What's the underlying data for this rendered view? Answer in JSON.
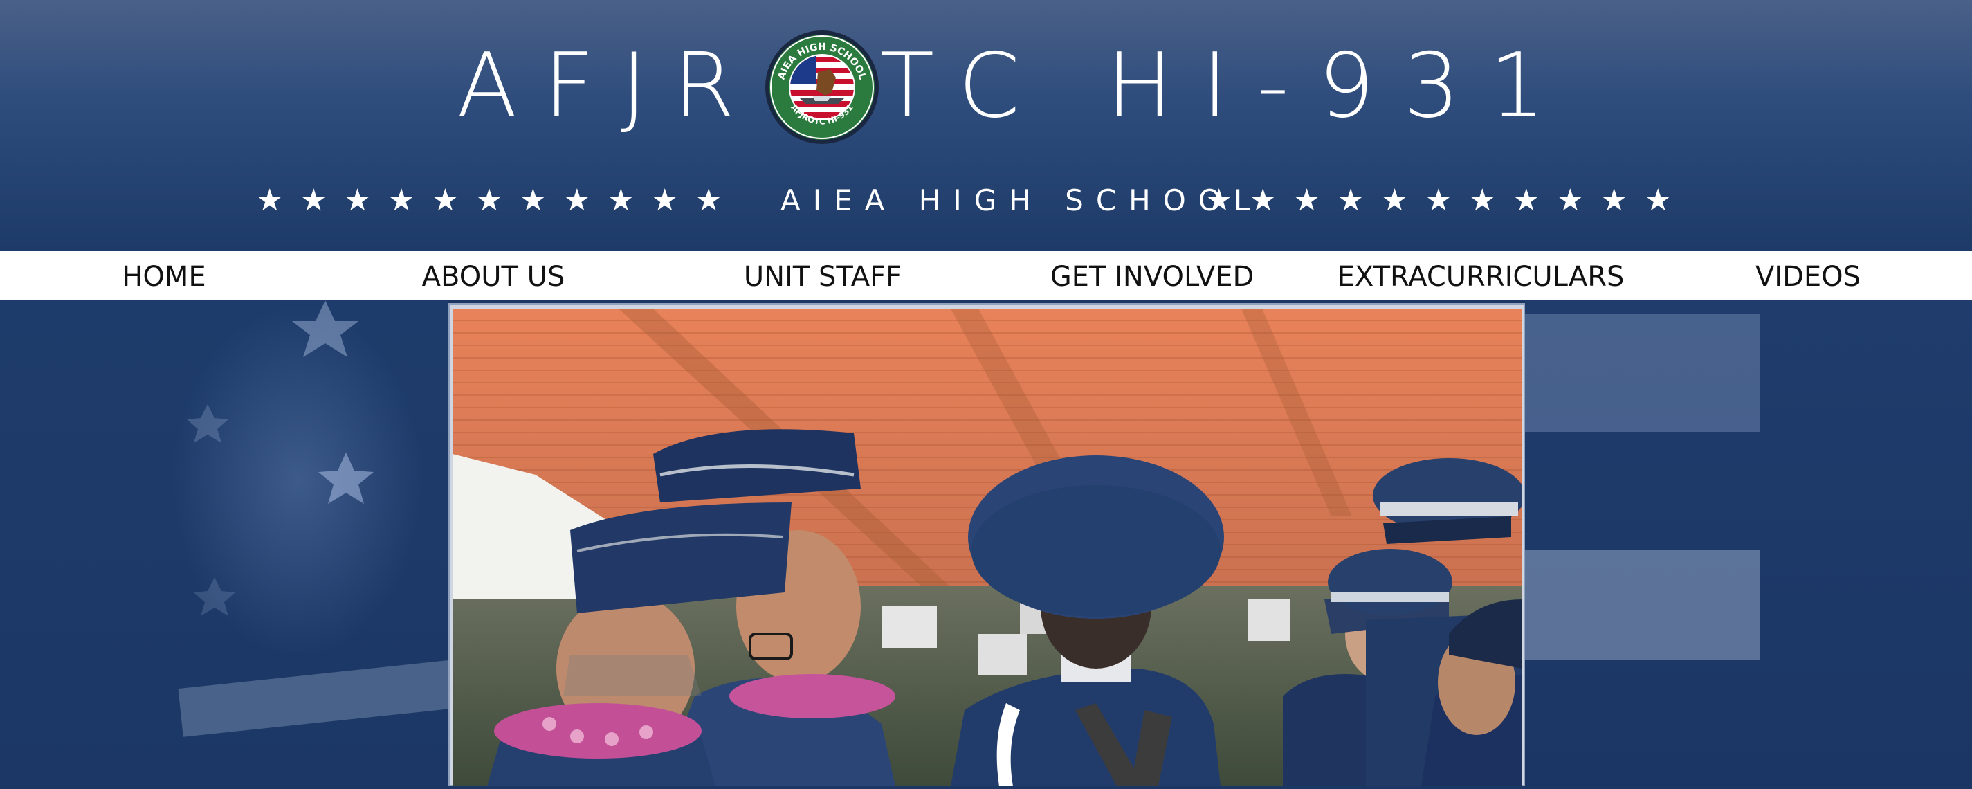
{
  "header": {
    "title_part1": "AFJR",
    "title_part2": "TC HI-931",
    "seal_top_text": "AIEA HIGH SCHOOL",
    "seal_bottom_text": "AFJROTC HI-931",
    "subtitle": "AIEA HIGH SCHOOL",
    "stars_left": "★★★★★★★★★★★",
    "stars_right": "★★★★★★★★★★★"
  },
  "nav": {
    "items": [
      {
        "label": "HOME"
      },
      {
        "label": "ABOUT US"
      },
      {
        "label": "UNIT STAFF"
      },
      {
        "label": "GET INVOLVED"
      },
      {
        "label": "EXTRACURRICULARS"
      },
      {
        "label": "VIDEOS"
      }
    ]
  },
  "colors": {
    "header_top": "#4a6188",
    "header_bottom": "#1d3a68",
    "nav_bg": "#ffffff",
    "nav_text": "#111111",
    "page_bg": "#1c3764",
    "stadium_seats": "#e07b52",
    "uniform": "#223a66"
  },
  "hero": {
    "image": "cadets-at-stadium-photo"
  }
}
